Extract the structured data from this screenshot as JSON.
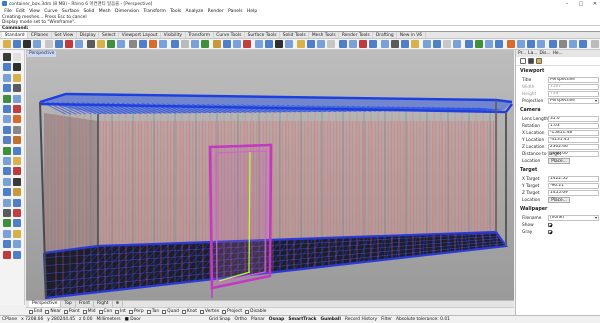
{
  "window": {
    "title": "container_box.3dm (8 MB) - Rhino 6 어컨맨티 일음을 - [Perspective]",
    "minimize_glyph": "–",
    "maximize_glyph": "□",
    "close_glyph": "✕"
  },
  "menu": [
    "File",
    "Edit",
    "View",
    "Curve",
    "Surface",
    "Solid",
    "Mesh",
    "Dimension",
    "Transform",
    "Tools",
    "Analyze",
    "Render",
    "Panels",
    "Help"
  ],
  "command_history": [
    "Creating meshes... Press Esc to cancel",
    "Display mode set to \"Wireframe\"."
  ],
  "command_prompt": "Command:",
  "tabs": {
    "items": [
      "Standard",
      "CPlanes",
      "Set View",
      "Display",
      "Select",
      "Viewport Layout",
      "Visibility",
      "Transform",
      "Curve Tools",
      "Surface Tools",
      "Solid Tools",
      "Mesh Tools",
      "Render Tools",
      "Drafting",
      "New in V6"
    ],
    "active": "Standard"
  },
  "toolbar_colors": [
    "#d7b24a",
    "#4f7fc8",
    "#2f2f2f",
    "#7aa0d8",
    "#c7c7c7",
    "#4f7fc8",
    "#bd3b3b",
    "#7aa0d8",
    "#5b5b5b",
    "#d7b24a",
    "#3f8f3f",
    "#7aa0d8",
    "#888888",
    "#4f7fc8",
    "#d76b2b",
    "#7aa0d8",
    "#4f7fc8",
    "#bbbbbb",
    "#7aa0d8",
    "#3f8f3f",
    "#c79b3b",
    "#4f7fc8",
    "#7aa0d8",
    "#c04040",
    "#7aa0d8",
    "#4f7fc8",
    "#2f2f2f",
    "#7aa0d8",
    "#d7b24a",
    "#4f7fc8",
    "#7aa0d8",
    "#c7c7c7",
    "#4f7fc8",
    "#7aa0d8",
    "#bd3b3b",
    "#4f7fc8",
    "#7aa0d8",
    "#5b5b5b",
    "#4f7fc8",
    "#d7b24a",
    "#7aa0d8",
    "#4f7fc8",
    "#c7c7c7",
    "#7aa0d8",
    "#4f7fc8",
    "#3f8f3f",
    "#7aa0d8",
    "#4f7fc8",
    "#d76b2b",
    "#7aa0d8",
    "#4f7fc8",
    "#7aa0d8",
    "#4f7fc8",
    "#888888",
    "#7aa0d8",
    "#4f7fc8",
    "#bbbbbb",
    "#7aa0d8",
    "#4f7fc8",
    "#7aa0d8",
    "#4f7fc8",
    "#7aa0d8",
    "#4f7fc8",
    "#c04040"
  ],
  "left_tool_colors": [
    "#3a3a3a",
    "#e0e0e0",
    "#4f7fc8",
    "#2f2f2f",
    "#7aa0d8",
    "#d7b24a",
    "#4f7fc8",
    "#5b5b5b",
    "#3f8f3f",
    "#7aa0d8",
    "#4f7fc8",
    "#c04040",
    "#7aa0d8",
    "#d76b2b",
    "#4f7fc8",
    "#888888",
    "#5b80c0",
    "#c07030",
    "#3f8f3f",
    "#4f7fc8",
    "#7aa0d8",
    "#d7b24a",
    "#4f7fc8",
    "#bd3b3b",
    "#7aa0d8",
    "#3a3a3a",
    "#4f7fc8",
    "#c79b3b",
    "#7aa0d8",
    "#4f7fc8",
    "#5b5b5b",
    "#c04040",
    "#3f8f3f",
    "#4f7fc8",
    "#7aa0d8",
    "#d7b24a",
    "#4f7fc8",
    "#7aa0d8",
    "#bd3b3b",
    "#4f7fc8"
  ],
  "viewport": {
    "label": "Perspective",
    "background": "#a3a3a3",
    "colors": {
      "roof": "#2f55e6",
      "wall_lines": "#e07a7a",
      "frame": "#555555",
      "door": "#c23ac2",
      "accent": "#b8ff2e",
      "floor": "#2230c8",
      "ground": "#9d9d9d"
    }
  },
  "viewport_tabs": {
    "items": [
      "Perspective",
      "Top",
      "Front",
      "Right"
    ],
    "active": "Perspective",
    "add_glyph": "⊕"
  },
  "osnap": [
    {
      "label": "End",
      "checked": false
    },
    {
      "label": "Near",
      "checked": false
    },
    {
      "label": "Point",
      "checked": false
    },
    {
      "label": "Mid",
      "checked": false
    },
    {
      "label": "Cen",
      "checked": false
    },
    {
      "label": "Int",
      "checked": false
    },
    {
      "label": "Perp",
      "checked": false
    },
    {
      "label": "Tan",
      "checked": false
    },
    {
      "label": "Quad",
      "checked": false
    },
    {
      "label": "Knot",
      "checked": false
    },
    {
      "label": "Vertex",
      "checked": false
    },
    {
      "label": "Project",
      "checked": false
    },
    {
      "label": "Disable",
      "checked": false
    }
  ],
  "status": {
    "cplane": "CPlane",
    "x": "x 7208.66",
    "y": "y 280244.45",
    "z": "z 0.00",
    "units": "Millimeters",
    "layer": "■ Door",
    "toggles": [
      "Grid Snap",
      "Ortho",
      "Planar",
      "Osnap",
      "SmartTrack",
      "Gumball",
      "Record History",
      "Filter",
      "Absolute tolerance: 0.01"
    ],
    "bold_toggles": [
      "Osnap",
      "SmartTrack",
      "Gumball"
    ]
  },
  "panel": {
    "tabs": [
      "Pr...",
      "La...",
      "Dis...",
      "He..."
    ],
    "viewport_section": "Viewport",
    "title": {
      "label": "Title",
      "value": "Perspective"
    },
    "width": {
      "label": "Width",
      "value": "1561"
    },
    "height": {
      "label": "Height",
      "value": "756"
    },
    "projection": {
      "label": "Projection",
      "value": "Perspective"
    },
    "camera_section": "Camera",
    "lens": {
      "label": "Lens Length",
      "value": "35.0"
    },
    "rotation": {
      "label": "Rotation",
      "value": "1.03"
    },
    "x_location": {
      "label": "X Location",
      "value": "-15811.48"
    },
    "y_location": {
      "label": "Y Location",
      "value": "-4131.45"
    },
    "z_location": {
      "label": "Z Location",
      "value": "2302.46"
    },
    "distance": {
      "label": "Distance to Target",
      "value": "5080.00"
    },
    "camera_location_button": {
      "label": "Location",
      "button": "Place..."
    },
    "target_section": "Target",
    "x_target": {
      "label": "X Target",
      "value": "1422.55"
    },
    "y_target": {
      "label": "Y Target",
      "value": "-96.21"
    },
    "z_target": {
      "label": "Z Target",
      "value": "1455.69"
    },
    "target_location_button": {
      "label": "Location",
      "button": "Place..."
    },
    "wallpaper_section": "Wallpaper",
    "filename": {
      "label": "Filename",
      "value": "(none)"
    },
    "show": {
      "label": "Show",
      "checked": true
    },
    "gray": {
      "label": "Gray",
      "checked": true
    }
  }
}
